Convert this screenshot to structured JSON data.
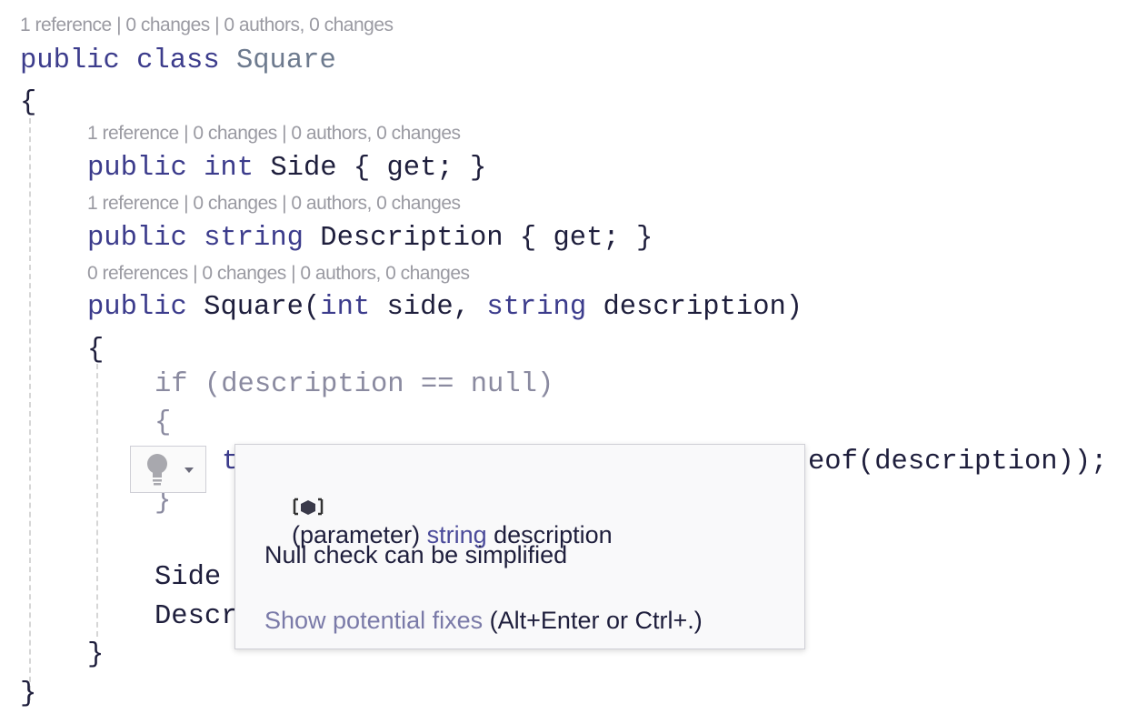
{
  "codelens": {
    "class": "1 reference | 0 changes | 0 authors, 0 changes",
    "side": "1 reference | 0 changes | 0 authors, 0 changes",
    "description": "1 reference | 0 changes | 0 authors, 0 changes",
    "ctor": "0 references | 0 changes | 0 authors, 0 changes"
  },
  "code": {
    "l1_kw": "public class",
    "l1_type": "Square",
    "open1": "{",
    "l2_kw": "public int",
    "l2_rest": "Side { get; }",
    "l3_kw": "public string",
    "l3_rest": "Description { get; }",
    "l4_kw": "public",
    "l4_a": "Square(",
    "l4_kw2": "int",
    "l4_b": "side,",
    "l4_kw3": "string",
    "l4_c": "description)",
    "open2": "{",
    "l5": "if (description == null)",
    "open3": "{",
    "l6_start": "t",
    "l6_end": "eof(description));",
    "close3": "}",
    "l7": "Side",
    "l8": "Descr",
    "close2": "}",
    "close1": "}"
  },
  "popup": {
    "symbol_icon": "parameter-icon",
    "sig_prefix": "(parameter)",
    "sig_type": "string",
    "sig_name": "description",
    "message": "Null check can be simplified",
    "fix_link": "Show potential fixes",
    "fix_shortcut": "(Alt+Enter or Ctrl+.)"
  },
  "lightbulb": {
    "icon": "lightbulb-icon",
    "dropdown": "chevron-down-icon"
  }
}
